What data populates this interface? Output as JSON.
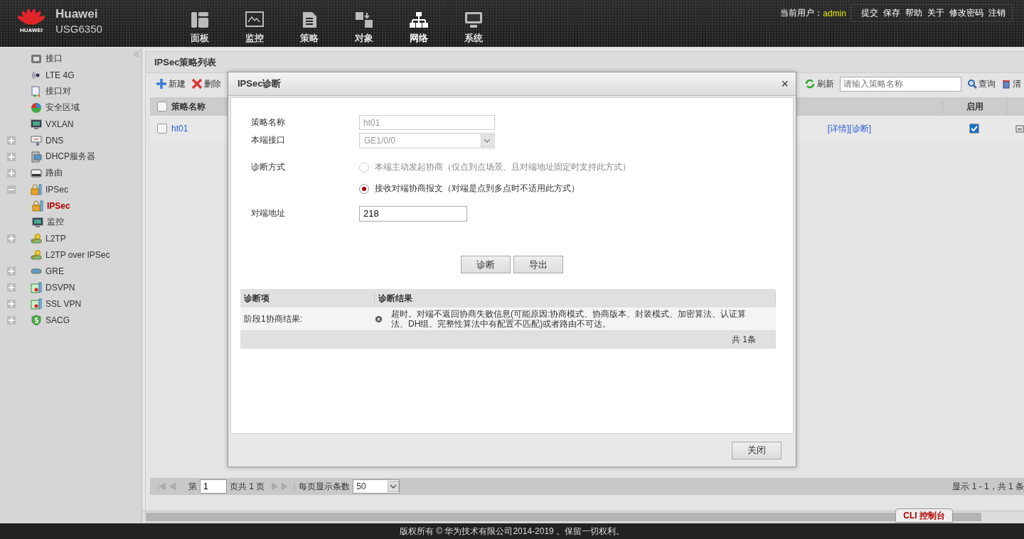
{
  "header": {
    "brand": "Huawei",
    "logo_text": "HUAWEI",
    "model": "USG6350",
    "nav": [
      {
        "label": "面板",
        "kind": "dashboard",
        "selected": false
      },
      {
        "label": "监控",
        "kind": "monitor",
        "selected": false
      },
      {
        "label": "策略",
        "kind": "document",
        "selected": false
      },
      {
        "label": "对象",
        "kind": "objects",
        "selected": false
      },
      {
        "label": "网络",
        "kind": "network",
        "selected": true
      },
      {
        "label": "系统",
        "kind": "system",
        "selected": false
      }
    ],
    "user_label": "当前用户：",
    "user": "admin",
    "links": [
      "提交",
      "保存",
      "帮助",
      "关于",
      "修改密码",
      "注销"
    ]
  },
  "sidebar": {
    "items": [
      {
        "label": "接口",
        "kind": "port",
        "selected": false
      },
      {
        "label": "LTE 4G",
        "kind": "wireless",
        "selected": false
      },
      {
        "label": "接口对",
        "kind": "pair",
        "selected": false
      },
      {
        "label": "安全区域",
        "kind": "pie",
        "selected": false
      },
      {
        "label": "VXLAN",
        "kind": "screen",
        "selected": false
      },
      {
        "label": "DNS",
        "kind": "dns",
        "selected": false,
        "expanded": false
      },
      {
        "label": "DHCP服务器",
        "kind": "server",
        "selected": false,
        "expanded": false
      },
      {
        "label": "路由",
        "kind": "router",
        "selected": false,
        "expanded": false
      },
      {
        "label": "IPSec",
        "kind": "lock",
        "selected": false,
        "expanded": true,
        "children": [
          {
            "label": "IPSec",
            "kind": "lock",
            "selected": true
          },
          {
            "label": "监控",
            "kind": "screen",
            "selected": false
          }
        ]
      },
      {
        "label": "L2TP",
        "kind": "key",
        "selected": false,
        "expanded": false
      },
      {
        "label": "L2TP over IPSec",
        "kind": "key",
        "selected": false
      },
      {
        "label": "GRE",
        "kind": "tunnel",
        "selected": false,
        "expanded": false
      },
      {
        "label": "DSVPN",
        "kind": "cert",
        "selected": false,
        "expanded": false
      },
      {
        "label": "SSL VPN",
        "kind": "cert",
        "selected": false,
        "expanded": false
      },
      {
        "label": "SACG",
        "kind": "shield",
        "selected": false,
        "expanded": false
      }
    ]
  },
  "page": {
    "title": "IPSec策略列表",
    "toolbar_left": [
      {
        "label": "新建",
        "kind": "add"
      },
      {
        "label": "删除",
        "kind": "delete"
      }
    ],
    "toolbar_right": [
      {
        "label": "刷新",
        "kind": "refresh"
      }
    ],
    "search": {
      "placeholder": "请输入策略名称"
    },
    "query": "查询",
    "clear": "清",
    "table": {
      "header_checked": false,
      "columns": [
        "策略名称",
        "启用"
      ],
      "rows": [
        {
          "name": "ht01",
          "checked": false,
          "links": [
            "[详情]",
            "[诊断]"
          ],
          "enabled": true
        }
      ]
    },
    "pager": {
      "before": "第",
      "page": "1",
      "after": "页共 1 页",
      "size_label": "每页显示条数",
      "size": "50",
      "summary": "显示 1 - 1，共 1 条"
    }
  },
  "dialog": {
    "title": "IPSec诊断",
    "close": "×",
    "fields": [
      {
        "label": "策略名称",
        "kind": "text",
        "value": "ht01",
        "disabled": true
      },
      {
        "label": "本端接口",
        "kind": "select",
        "value": "GE1/0/0",
        "disabled": true
      }
    ],
    "mode_label": "诊断方式",
    "modes": [
      {
        "label": "本端主动发起协商（仅点到点场景、且对端地址固定时支持此方式）",
        "disabled": true,
        "selected": false
      },
      {
        "label": "接收对端协商报文（对端是点到多点时不适用此方式）",
        "disabled": false,
        "selected": true
      }
    ],
    "peer_label": "对端地址",
    "peer_value": "218",
    "actions": [
      "诊断",
      "导出"
    ],
    "results": {
      "columns": [
        "诊断项",
        "诊断结果"
      ],
      "rows": [
        {
          "item": "阶段1协商结果:",
          "kind": "error",
          "result": "超时。对端不返回协商失败信息(可能原因:协商模式、协商版本、封装模式、加密算法、认证算法、DH组、完整性算法中有配置不匹配)或者路由不可达。"
        }
      ],
      "total": "共 1条"
    },
    "footer_button": "关闭"
  },
  "console_tab": "CLI 控制台",
  "footer": "版权所有 © 华为技术有限公司2014-2019 。保留一切权利。"
}
